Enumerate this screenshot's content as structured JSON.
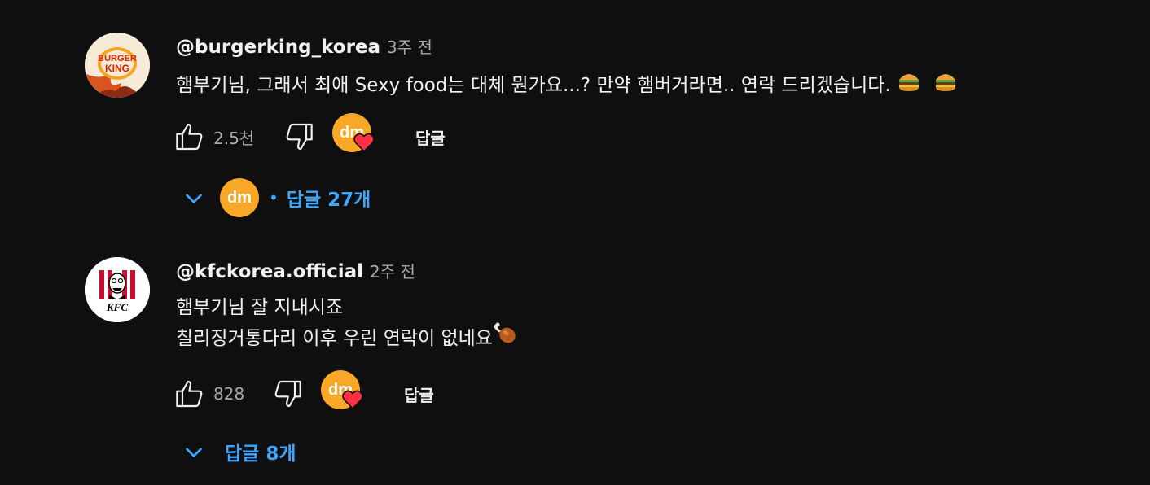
{
  "comments": [
    {
      "author": "@burgerking_korea",
      "time": "3주 전",
      "text_lines": [
        "햄부기님, 그래서 최애 Sexy food는 대체 뭔가요...? 만약 햄버거라면.. 연락 드리겠습니다. "
      ],
      "emojis": [
        "burger-emoji",
        "burger-emoji"
      ],
      "like_count": "2.5천",
      "reply_label": "답글",
      "replies_label": "답글 27개",
      "avatar_text_top": "BURGER",
      "avatar_text_bottom": "KING"
    },
    {
      "author": "@kfckorea.official",
      "time": "2주 전",
      "text_lines": [
        "햄부기님 잘 지내시죠",
        "칠리징거통다리 이후 우린 연락이 없네요"
      ],
      "emojis": [
        "chicken-leg-emoji"
      ],
      "like_count": "828",
      "reply_label": "답글",
      "replies_label": "답글 8개",
      "avatar_text": "KFC"
    }
  ],
  "creator_avatar_text": "dm",
  "colors": {
    "background": "#0f0f0f",
    "link_blue": "#3ea6ff",
    "heart_red": "#ff3040",
    "dm_orange": "#f8a826"
  }
}
